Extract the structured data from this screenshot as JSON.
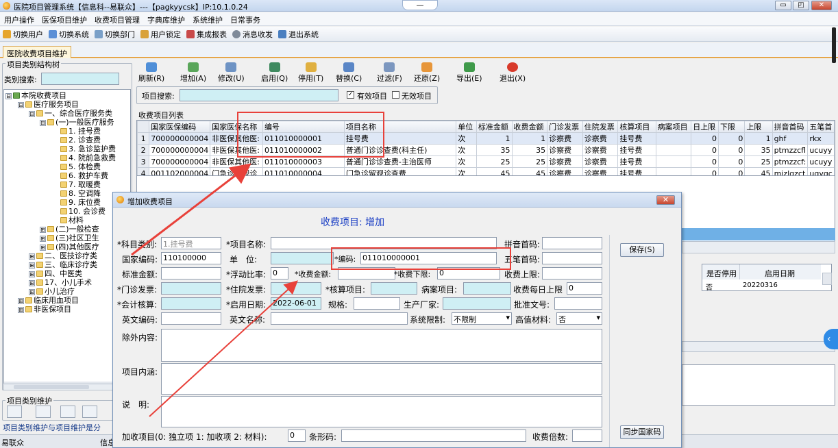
{
  "window": {
    "title": "医院项目管理系统【信息科--易联众】---【pagkyycsk】IP:10.1.0.24",
    "mid": "— ⌄",
    "min": "▭",
    "max": "◰",
    "close": "✕"
  },
  "menu": [
    "用户操作",
    "医保项目维护",
    "收费项目管理",
    "字典库维护",
    "系统维护",
    "日常事务"
  ],
  "toolbar": [
    "切换用户",
    "切换系统",
    "切换部门",
    "用户锁定",
    "集成报表",
    "消息收发",
    "退出系统"
  ],
  "tab": "医院收费项目维护",
  "left": {
    "group_title": "项目类别结构树",
    "search_label": "类别搜索:",
    "bottom_group": "项目类别维护",
    "status": "项目类别维护与项目维护是分",
    "footer_left": "易联众",
    "footer_right": "信息科"
  },
  "tree": [
    {
      "t": "本院收费项目",
      "pm": "⊟"
    },
    {
      "t": "医疗服务项目",
      "pm": "⊟"
    },
    {
      "t": "一、综合医疗服务类",
      "pm": "⊟"
    },
    {
      "t": "(一)一般医疗服务",
      "pm": "⊟"
    },
    {
      "t": "1. 挂号费"
    },
    {
      "t": "2. 诊查费"
    },
    {
      "t": "3. 急诊监护费"
    },
    {
      "t": "4. 院前急救费"
    },
    {
      "t": "5. 体检费"
    },
    {
      "t": "6. 救护车费"
    },
    {
      "t": "7. 取暖费"
    },
    {
      "t": "8. 空调降"
    },
    {
      "t": "9. 床位费"
    },
    {
      "t": "10. 会诊费"
    },
    {
      "t": "材料"
    },
    {
      "t": "(二)一般检查",
      "pm": "⊞"
    },
    {
      "t": "(三)社区卫生",
      "pm": "⊞"
    },
    {
      "t": "(四)其他医疗",
      "pm": "⊞"
    },
    {
      "t": "二、医技诊疗类",
      "pm": "⊞"
    },
    {
      "t": "三、临床诊疗类",
      "pm": "⊞"
    },
    {
      "t": "四、中医类",
      "pm": "⊞"
    },
    {
      "t": "17、小儿手术",
      "pm": "⊞"
    },
    {
      "t": "小儿治疗",
      "pm": "⊞"
    },
    {
      "t": "临床用血项目",
      "pm": "⊞"
    },
    {
      "t": "非医保项目",
      "pm": "⊞"
    }
  ],
  "actions": [
    "刷新(R)",
    "增加(A)",
    "修改(U)",
    "启用(Q)",
    "停用(T)",
    "替换(C)",
    "过滤(F)",
    "还原(Z)",
    "导出(E)",
    "退出(X)"
  ],
  "search": {
    "label": "项目搜索:",
    "valid": "有效项目",
    "invalid": "无效项目"
  },
  "list": {
    "title": "收费项目列表",
    "headers": [
      "国家医保编码",
      "国家医保名称",
      "编号",
      "项目名称",
      "单位",
      "标准金额",
      "收费金额",
      "门诊发票",
      "住院发票",
      "核算项目",
      "病案项目",
      "日上限",
      "下限",
      "上限",
      "拼音首码",
      "五笔首"
    ],
    "rows": [
      [
        "1",
        "700000000004",
        "非医保其他医:",
        "011010000001",
        "挂号费",
        "次",
        "1",
        "1",
        "诊察费",
        "诊察费",
        "挂号费",
        "",
        "0",
        "0",
        "1",
        "ghf",
        "rkx"
      ],
      [
        "2",
        "700000000004",
        "非医保其他医:",
        "011010000002",
        "普通门诊诊查费(科主任)",
        "次",
        "35",
        "35",
        "诊察费",
        "诊察费",
        "挂号费",
        "",
        "0",
        "0",
        "35",
        "ptmzzcfl",
        "ucuyy"
      ],
      [
        "3",
        "700000000004",
        "非医保其他医:",
        "011010000003",
        "普通门诊诊查费-主治医师",
        "次",
        "25",
        "25",
        "诊察费",
        "诊察费",
        "挂号费",
        "",
        "0",
        "0",
        "25",
        "ptmzzcf:",
        "ucuyy"
      ],
      [
        "4",
        "001102000004",
        "门急诊留观诊",
        "011010000004",
        "门急诊留观诊查费",
        "次",
        "45",
        "45",
        "诊察费",
        "诊察费",
        "挂号费",
        "",
        "0",
        "0",
        "45",
        "mjzlgzct",
        "uqyqc"
      ]
    ]
  },
  "sub": {
    "h1": "是否停用",
    "h2": "启用日期",
    "v1": "否",
    "v2": "20220316"
  },
  "dialog": {
    "title": "增加收费项目",
    "heading": "收费项目: 增加",
    "save": "保存(S)",
    "sync": "同步国家码",
    "f": {
      "cat_l": "*科目类别:",
      "cat_v": "1.挂号费",
      "name_l": "*项目名称:",
      "py_l": "拼音首码:",
      "nat_l": "国家编码:",
      "nat_v": "110100000",
      "unit_l": "单　位:",
      "code_l": "*编码:",
      "code_v": "011010000001",
      "wb_l": "五笔首码:",
      "std_l": "标准金额:",
      "float_l": "*浮动比率:",
      "float_v": "0",
      "fee_l": "*收费金额:",
      "low_l": "*收费下限:",
      "low_v": "0",
      "up_l": "收费上限:",
      "op_l": "*门诊发票:",
      "ip_l": "*住院发票:",
      "acc_l": "*核算项目:",
      "case_l": "病案项目:",
      "day_l": "收费每日上限",
      "day_v": "0",
      "ac2_l": "*会计核算:",
      "start_l": "*启用日期:",
      "start_v": "2022-06-01",
      "spec_l": "规格:",
      "mfr_l": "生产厂家:",
      "appr_l": "批准文号:",
      "en_l": "英文编码:",
      "enn_l": "英文名称:",
      "sys_l": "系统限制:",
      "sys_v": "不限制",
      "hv_l": "高值材料:",
      "hv_v": "否",
      "exc_l": "除外内容:",
      "inc_l": "项目内涵:",
      "desc_l": "说　明:",
      "add_l": "加收项目(0: 独立项 1: 加收项 2: 材料):",
      "add_v": "0",
      "bar_l": "条形码:",
      "mult_l": "收费倍数:"
    }
  }
}
